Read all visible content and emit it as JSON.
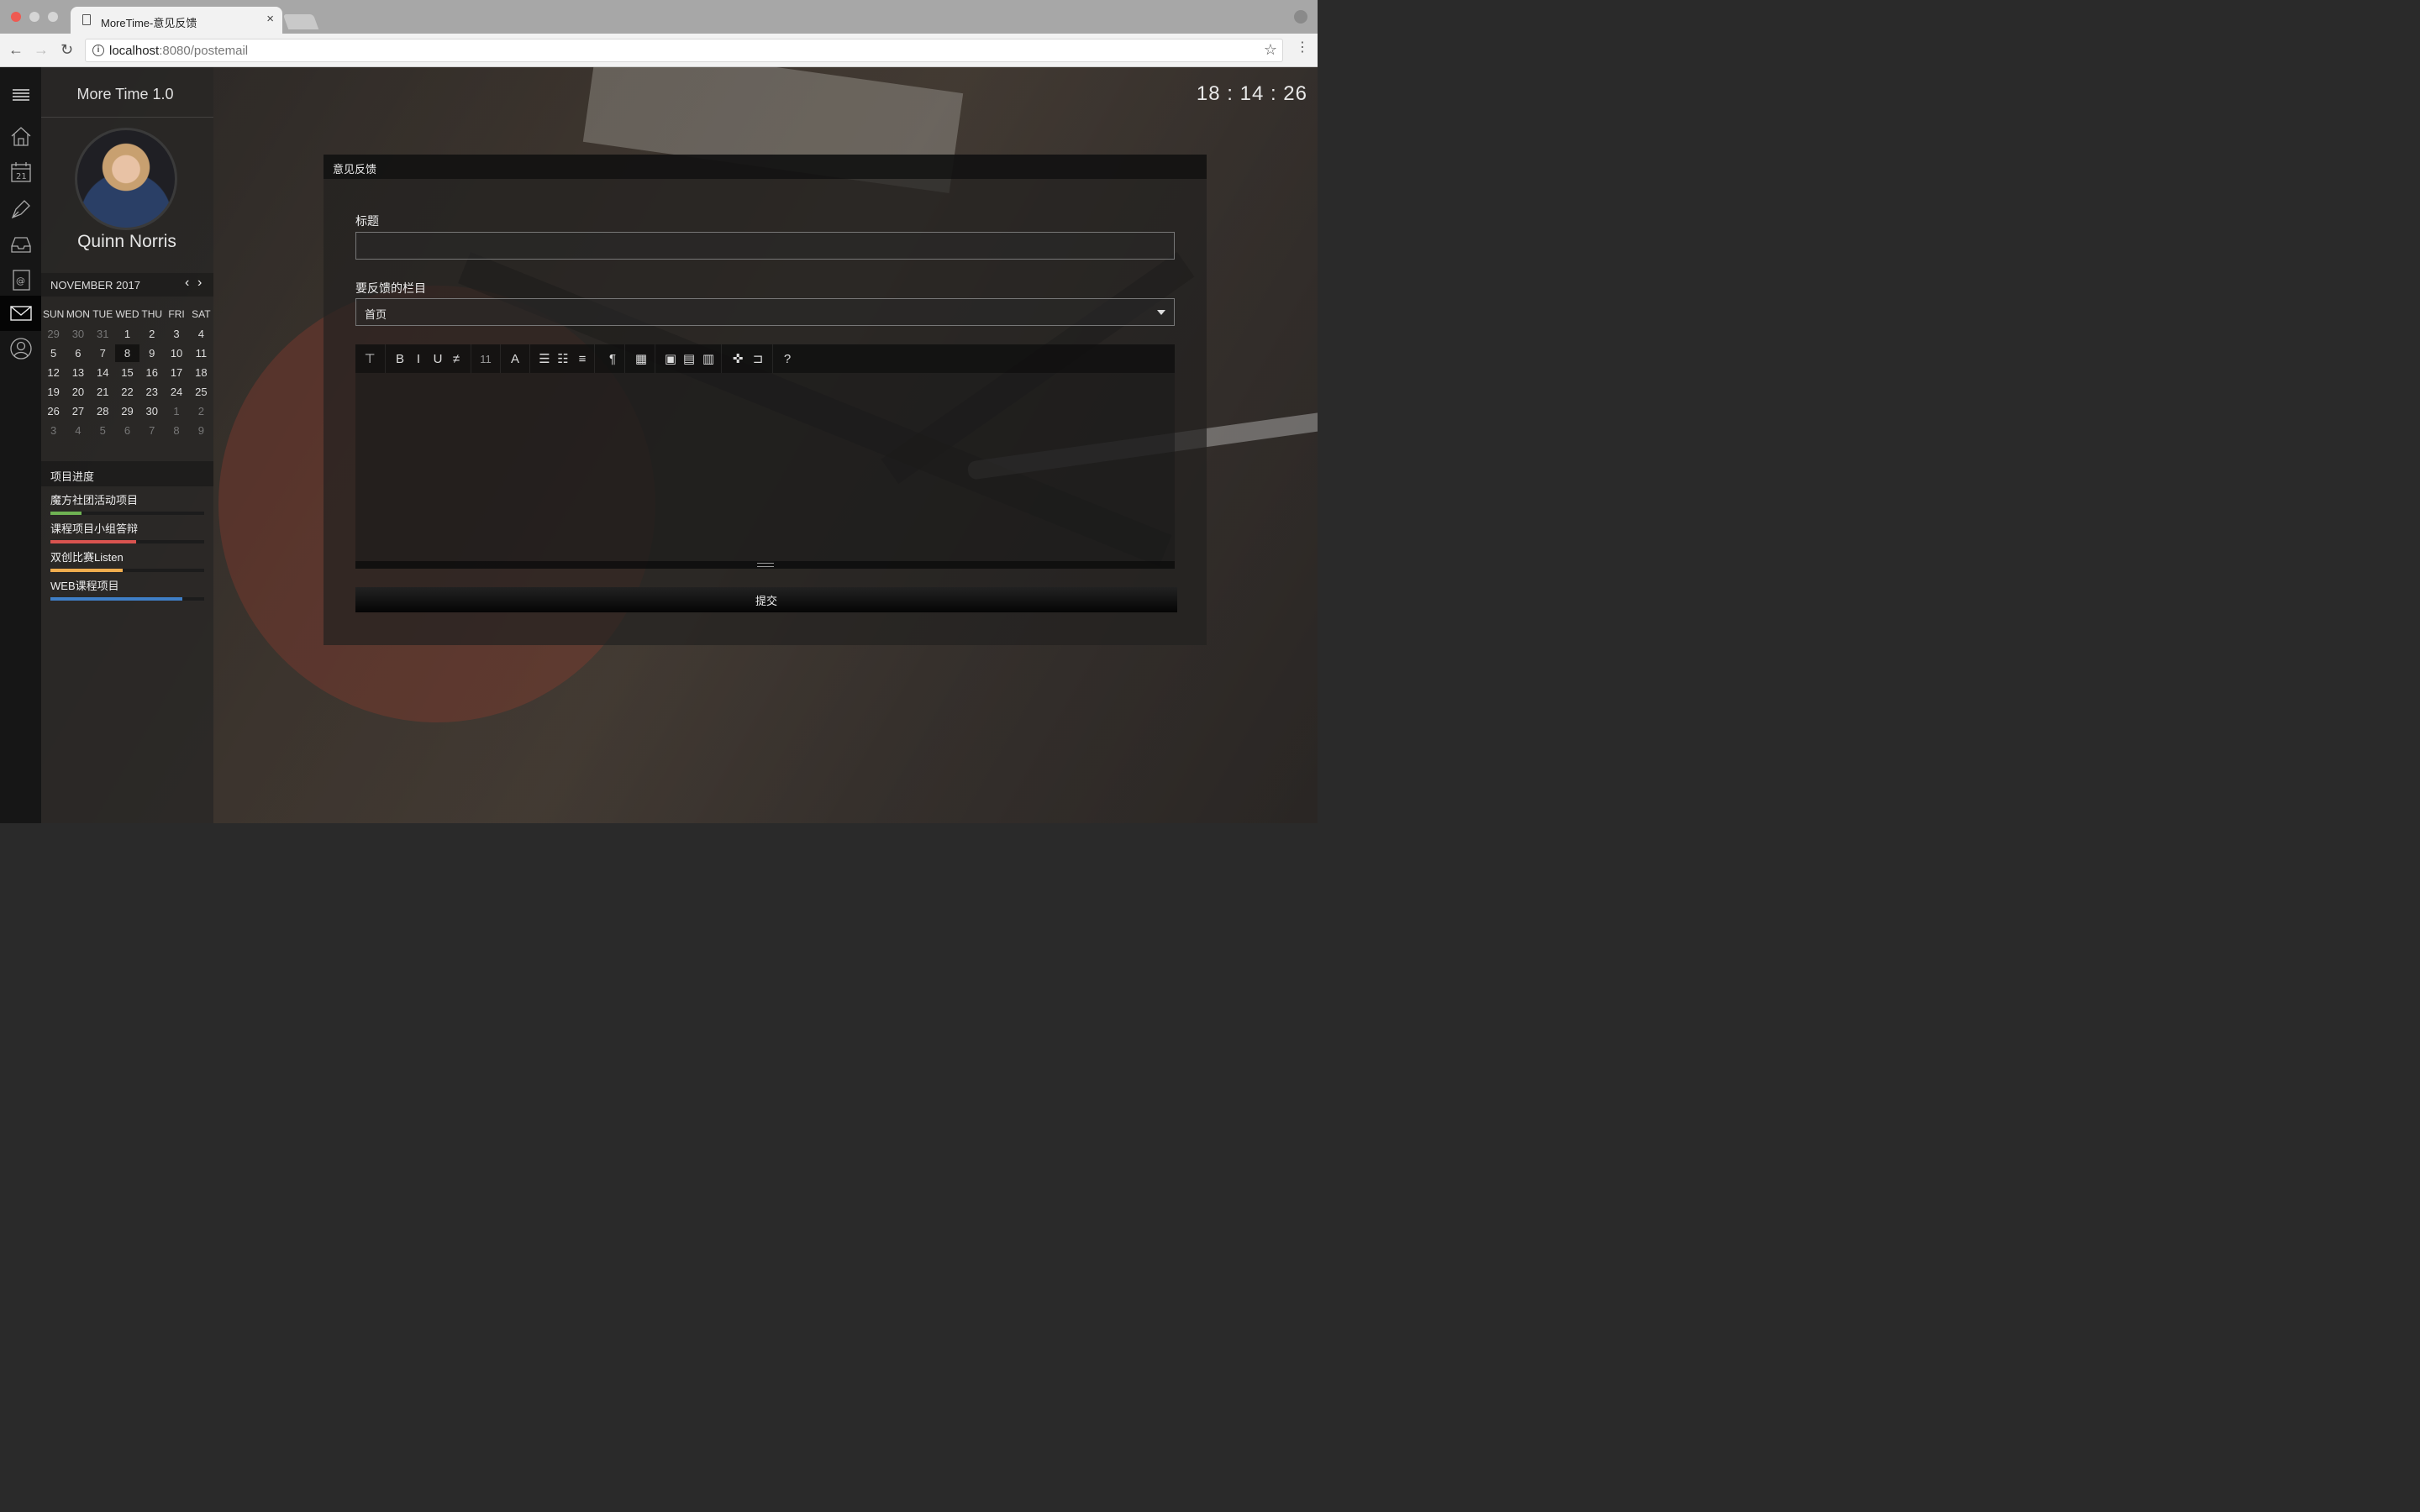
{
  "browser": {
    "tab_title": "MoreTime-意见反馈",
    "tab_close": "×",
    "url_host": "localhost",
    "url_rest": ":8080/postemail"
  },
  "app": {
    "brand": "More Time 1.0",
    "clock": "18 : 14 : 26",
    "username": "Quinn Norris"
  },
  "rail_icons": [
    "menu-icon",
    "home-icon",
    "calendar-icon",
    "pen-icon",
    "inbox-icon",
    "contacts-icon",
    "mail-icon",
    "user-icon"
  ],
  "calendar": {
    "month": "NOVEMBER 2017",
    "weekdays": [
      "SUN",
      "MON",
      "TUE",
      "WED",
      "THU",
      "FRI",
      "SAT"
    ],
    "weeks": [
      [
        {
          "d": "29",
          "m": true
        },
        {
          "d": "30",
          "m": true
        },
        {
          "d": "31",
          "m": true
        },
        {
          "d": "1"
        },
        {
          "d": "2"
        },
        {
          "d": "3"
        },
        {
          "d": "4"
        }
      ],
      [
        {
          "d": "5"
        },
        {
          "d": "6"
        },
        {
          "d": "7"
        },
        {
          "d": "8",
          "today": true
        },
        {
          "d": "9"
        },
        {
          "d": "10"
        },
        {
          "d": "11"
        }
      ],
      [
        {
          "d": "12"
        },
        {
          "d": "13"
        },
        {
          "d": "14"
        },
        {
          "d": "15"
        },
        {
          "d": "16"
        },
        {
          "d": "17"
        },
        {
          "d": "18"
        }
      ],
      [
        {
          "d": "19"
        },
        {
          "d": "20"
        },
        {
          "d": "21"
        },
        {
          "d": "22"
        },
        {
          "d": "23"
        },
        {
          "d": "24"
        },
        {
          "d": "25"
        }
      ],
      [
        {
          "d": "26"
        },
        {
          "d": "27"
        },
        {
          "d": "28"
        },
        {
          "d": "29"
        },
        {
          "d": "30"
        },
        {
          "d": "1",
          "m": true
        },
        {
          "d": "2",
          "m": true
        }
      ],
      [
        {
          "d": "3",
          "m": true
        },
        {
          "d": "4",
          "m": true
        },
        {
          "d": "5",
          "m": true
        },
        {
          "d": "6",
          "m": true
        },
        {
          "d": "7",
          "m": true
        },
        {
          "d": "8",
          "m": true
        },
        {
          "d": "9",
          "m": true
        }
      ]
    ]
  },
  "progress": {
    "title": "项目进度",
    "items": [
      {
        "label": "魔方社团活动项目",
        "percent": 20,
        "color": "#6fb353"
      },
      {
        "label": "课程项目小组答辩",
        "percent": 56,
        "color": "#d9534f"
      },
      {
        "label": "双创比赛Listen",
        "percent": 47,
        "color": "#f0ad4e"
      },
      {
        "label": "WEB课程项目",
        "percent": 86,
        "color": "#3f7fc7"
      }
    ]
  },
  "form": {
    "panel_title": "意见反馈",
    "title_label": "标题",
    "title_value": "",
    "section_label": "要反馈的栏目",
    "section_value": "首页",
    "submit_label": "提交"
  },
  "editor_toolbar": [
    "paragraph-format-icon",
    "bold-icon",
    "italic-icon",
    "underline-icon",
    "strikethrough-icon",
    "font-size-icon",
    "font-color-icon",
    "ordered-list-icon",
    "unordered-list-icon",
    "align-icon",
    "text-direction-icon",
    "table-icon",
    "insert-image-icon",
    "insert-media-icon",
    "insert-video-icon",
    "fullscreen-icon",
    "code-view-icon",
    "help-icon"
  ],
  "editor_font_size": "11"
}
